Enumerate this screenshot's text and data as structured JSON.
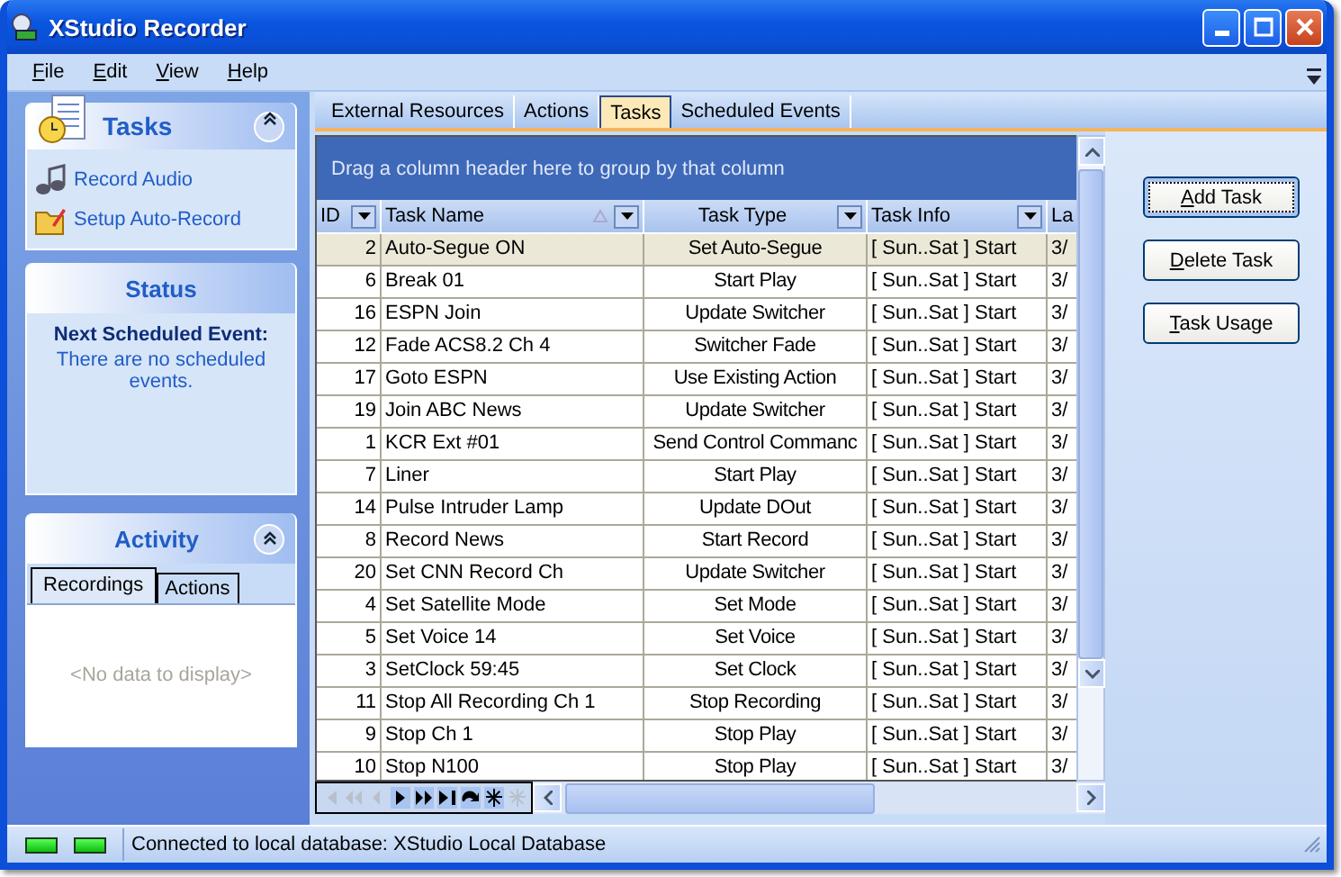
{
  "window": {
    "title": "XStudio Recorder"
  },
  "menu": [
    {
      "label": "File"
    },
    {
      "label": "Edit"
    },
    {
      "label": "View"
    },
    {
      "label": "Help"
    }
  ],
  "tasks_panel": {
    "title": "Tasks",
    "links": [
      {
        "label": "Record Audio",
        "kind": "audio"
      },
      {
        "label": "Setup Auto-Record",
        "kind": "setup"
      }
    ]
  },
  "status_panel": {
    "title": "Status",
    "heading": "Next Scheduled Event:",
    "message": "There are no scheduled events."
  },
  "activity_panel": {
    "title": "Activity",
    "tabs": [
      {
        "label": "Recordings",
        "selected": true
      },
      {
        "label": "Actions",
        "selected": false
      }
    ],
    "empty_text": "<No data to display>"
  },
  "tabs": [
    {
      "label": "External Resources",
      "selected": false
    },
    {
      "label": "Actions",
      "selected": false
    },
    {
      "label": "Tasks",
      "selected": true
    },
    {
      "label": "Scheduled Events",
      "selected": false
    }
  ],
  "group_hint": "Drag a column header here to group by that column",
  "table": {
    "columns": [
      {
        "label": "ID",
        "filter": true
      },
      {
        "label": "Task Name",
        "filter": true,
        "sorted": true
      },
      {
        "label": "Task Type",
        "filter": true
      },
      {
        "label": "Task Info",
        "filter": true
      },
      {
        "label": "La",
        "filter": false
      }
    ],
    "rows": [
      {
        "cells": [
          "2",
          "Auto-Segue ON",
          "Set Auto-Segue",
          "[ Sun..Sat ] Start",
          "3/"
        ],
        "selected": true
      },
      {
        "cells": [
          "6",
          "Break 01",
          "Start Play",
          "[ Sun..Sat ] Start",
          "3/"
        ],
        "selected": false
      },
      {
        "cells": [
          "16",
          "ESPN Join",
          "Update Switcher",
          "[ Sun..Sat ] Start",
          "3/"
        ],
        "selected": false
      },
      {
        "cells": [
          "12",
          "Fade ACS8.2 Ch 4",
          "Switcher Fade",
          "[ Sun..Sat ] Start",
          "3/"
        ],
        "selected": false
      },
      {
        "cells": [
          "17",
          "Goto ESPN",
          "Use Existing Action",
          "[ Sun..Sat ] Start",
          "3/"
        ],
        "selected": false
      },
      {
        "cells": [
          "19",
          "Join ABC News",
          "Update Switcher",
          "[ Sun..Sat ] Start",
          "3/"
        ],
        "selected": false
      },
      {
        "cells": [
          "1",
          "KCR Ext #01",
          "Send Control Commanc",
          "[ Sun..Sat ] Start",
          "3/"
        ],
        "selected": false
      },
      {
        "cells": [
          "7",
          "Liner",
          "Start Play",
          "[ Sun..Sat ] Start",
          "3/"
        ],
        "selected": false
      },
      {
        "cells": [
          "14",
          "Pulse Intruder Lamp",
          "Update DOut",
          "[ Sun..Sat ] Start",
          "3/"
        ],
        "selected": false
      },
      {
        "cells": [
          "8",
          "Record News",
          "Start Record",
          "[ Sun..Sat ] Start",
          "3/"
        ],
        "selected": false
      },
      {
        "cells": [
          "20",
          "Set CNN Record Ch",
          "Update Switcher",
          "[ Sun..Sat ] Start",
          "3/"
        ],
        "selected": false
      },
      {
        "cells": [
          "4",
          "Set Satellite Mode",
          "Set Mode",
          "[ Sun..Sat ] Start",
          "3/"
        ],
        "selected": false
      },
      {
        "cells": [
          "5",
          "Set Voice 14",
          "Set Voice",
          "[ Sun..Sat ] Start",
          "3/"
        ],
        "selected": false
      },
      {
        "cells": [
          "3",
          "SetClock 59:45",
          "Set Clock",
          "[ Sun..Sat ] Start",
          "3/"
        ],
        "selected": false
      },
      {
        "cells": [
          "11",
          "Stop All Recording Ch 1",
          "Stop Recording",
          "[ Sun..Sat ] Start",
          "3/"
        ],
        "selected": false
      },
      {
        "cells": [
          "9",
          "Stop Ch 1",
          "Stop Play",
          "[ Sun..Sat ] Start",
          "3/"
        ],
        "selected": false
      },
      {
        "cells": [
          "10",
          "Stop N100",
          "Stop Play",
          "[ Sun..Sat ] Start",
          "3/"
        ],
        "selected": false
      }
    ]
  },
  "buttons": [
    {
      "label": "Add Task",
      "focused": true
    },
    {
      "label": "Delete Task",
      "focused": false
    },
    {
      "label": "Task Usage",
      "focused": false
    }
  ],
  "status_bar": {
    "text": "Connected to local database: XStudio Local Database",
    "leds": [
      {
        "on": true
      },
      {
        "on": true
      }
    ]
  }
}
